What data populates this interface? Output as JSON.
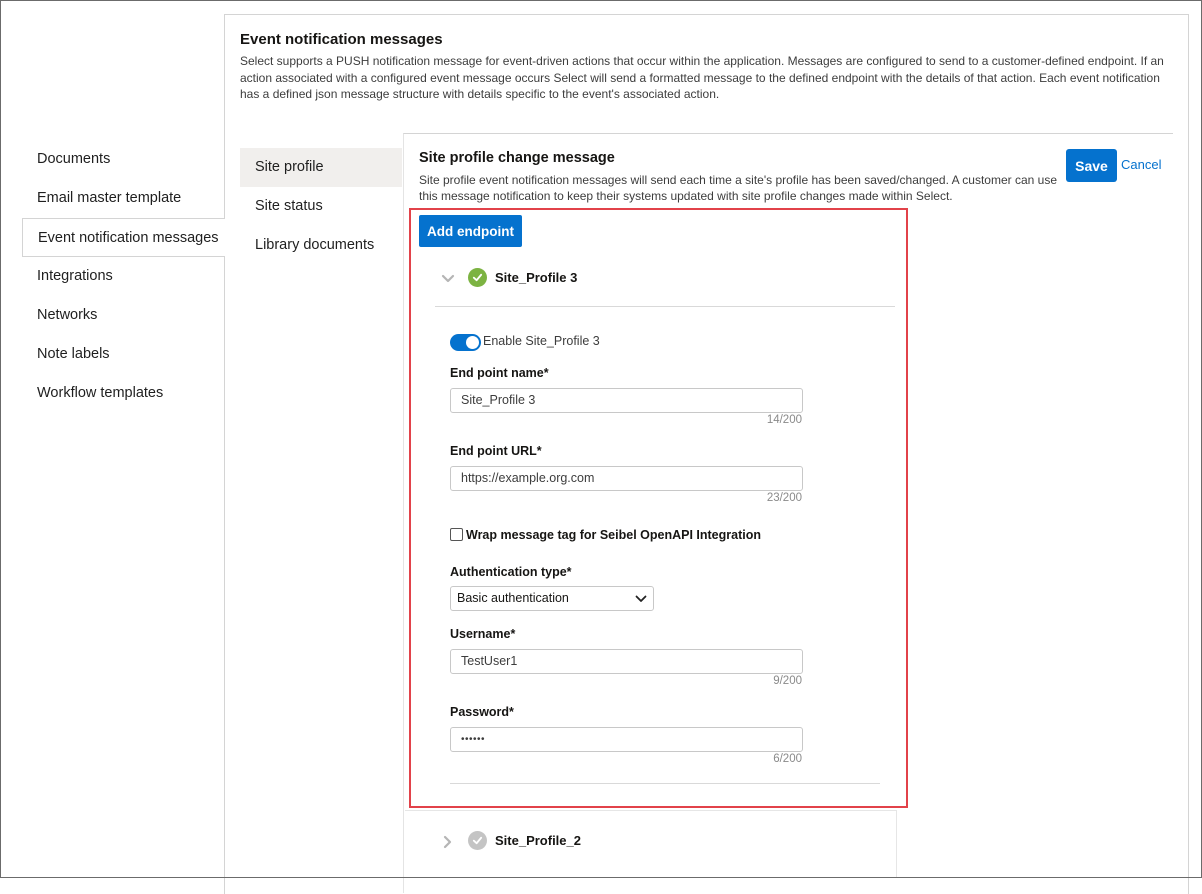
{
  "left_nav": {
    "items": [
      {
        "label": "Documents"
      },
      {
        "label": "Email master template"
      },
      {
        "label": "Event notification messages"
      },
      {
        "label": "Integrations"
      },
      {
        "label": "Networks"
      },
      {
        "label": "Note labels"
      },
      {
        "label": "Workflow templates"
      }
    ],
    "active_index": 2
  },
  "page": {
    "title": "Event notification messages",
    "description": "Select supports a PUSH notification message for event-driven actions that occur within the application. Messages are configured to send to a customer-defined endpoint. If an action associated with a configured event message occurs Select will send a formatted message to the defined endpoint with the details of that action. Each event notification has a defined json message structure with details specific to the event's associated action."
  },
  "sub_nav": {
    "items": [
      {
        "label": "Site profile"
      },
      {
        "label": "Site status"
      },
      {
        "label": "Library documents"
      }
    ],
    "active_index": 0
  },
  "section": {
    "title": "Site profile change message",
    "description": "Site profile event notification messages will send each time a site's profile has been saved/changed. A customer can use this message notification to keep their systems updated with site profile changes made within Select.",
    "save_label": "Save",
    "cancel_label": "Cancel"
  },
  "endpoints": {
    "add_label": "Add endpoint",
    "expanded": {
      "name": "Site_Profile 3",
      "status": "enabled",
      "enable_label": "Enable Site_Profile 3",
      "enabled": true,
      "endpoint_name_label": "End point name*",
      "endpoint_name_value": "Site_Profile 3",
      "endpoint_name_count": "14/200",
      "endpoint_url_label": "End point URL*",
      "endpoint_url_value": "https://example.org.com",
      "endpoint_url_count": "23/200",
      "wrap_label": "Wrap message tag for Seibel OpenAPI Integration",
      "wrap_checked": false,
      "auth_type_label": "Authentication type*",
      "auth_type_value": "Basic authentication",
      "username_label": "Username*",
      "username_value": "TestUser1",
      "username_count": "9/200",
      "password_label": "Password*",
      "password_value": "••••••",
      "password_count": "6/200"
    },
    "collapsed": [
      {
        "name": "Site_Profile_2",
        "status": "disabled"
      }
    ]
  },
  "colors": {
    "accent": "#0572ce",
    "highlight_border": "#e2424a",
    "enabled_check": "#7cb342",
    "disabled_check": "#c4c4c4"
  }
}
